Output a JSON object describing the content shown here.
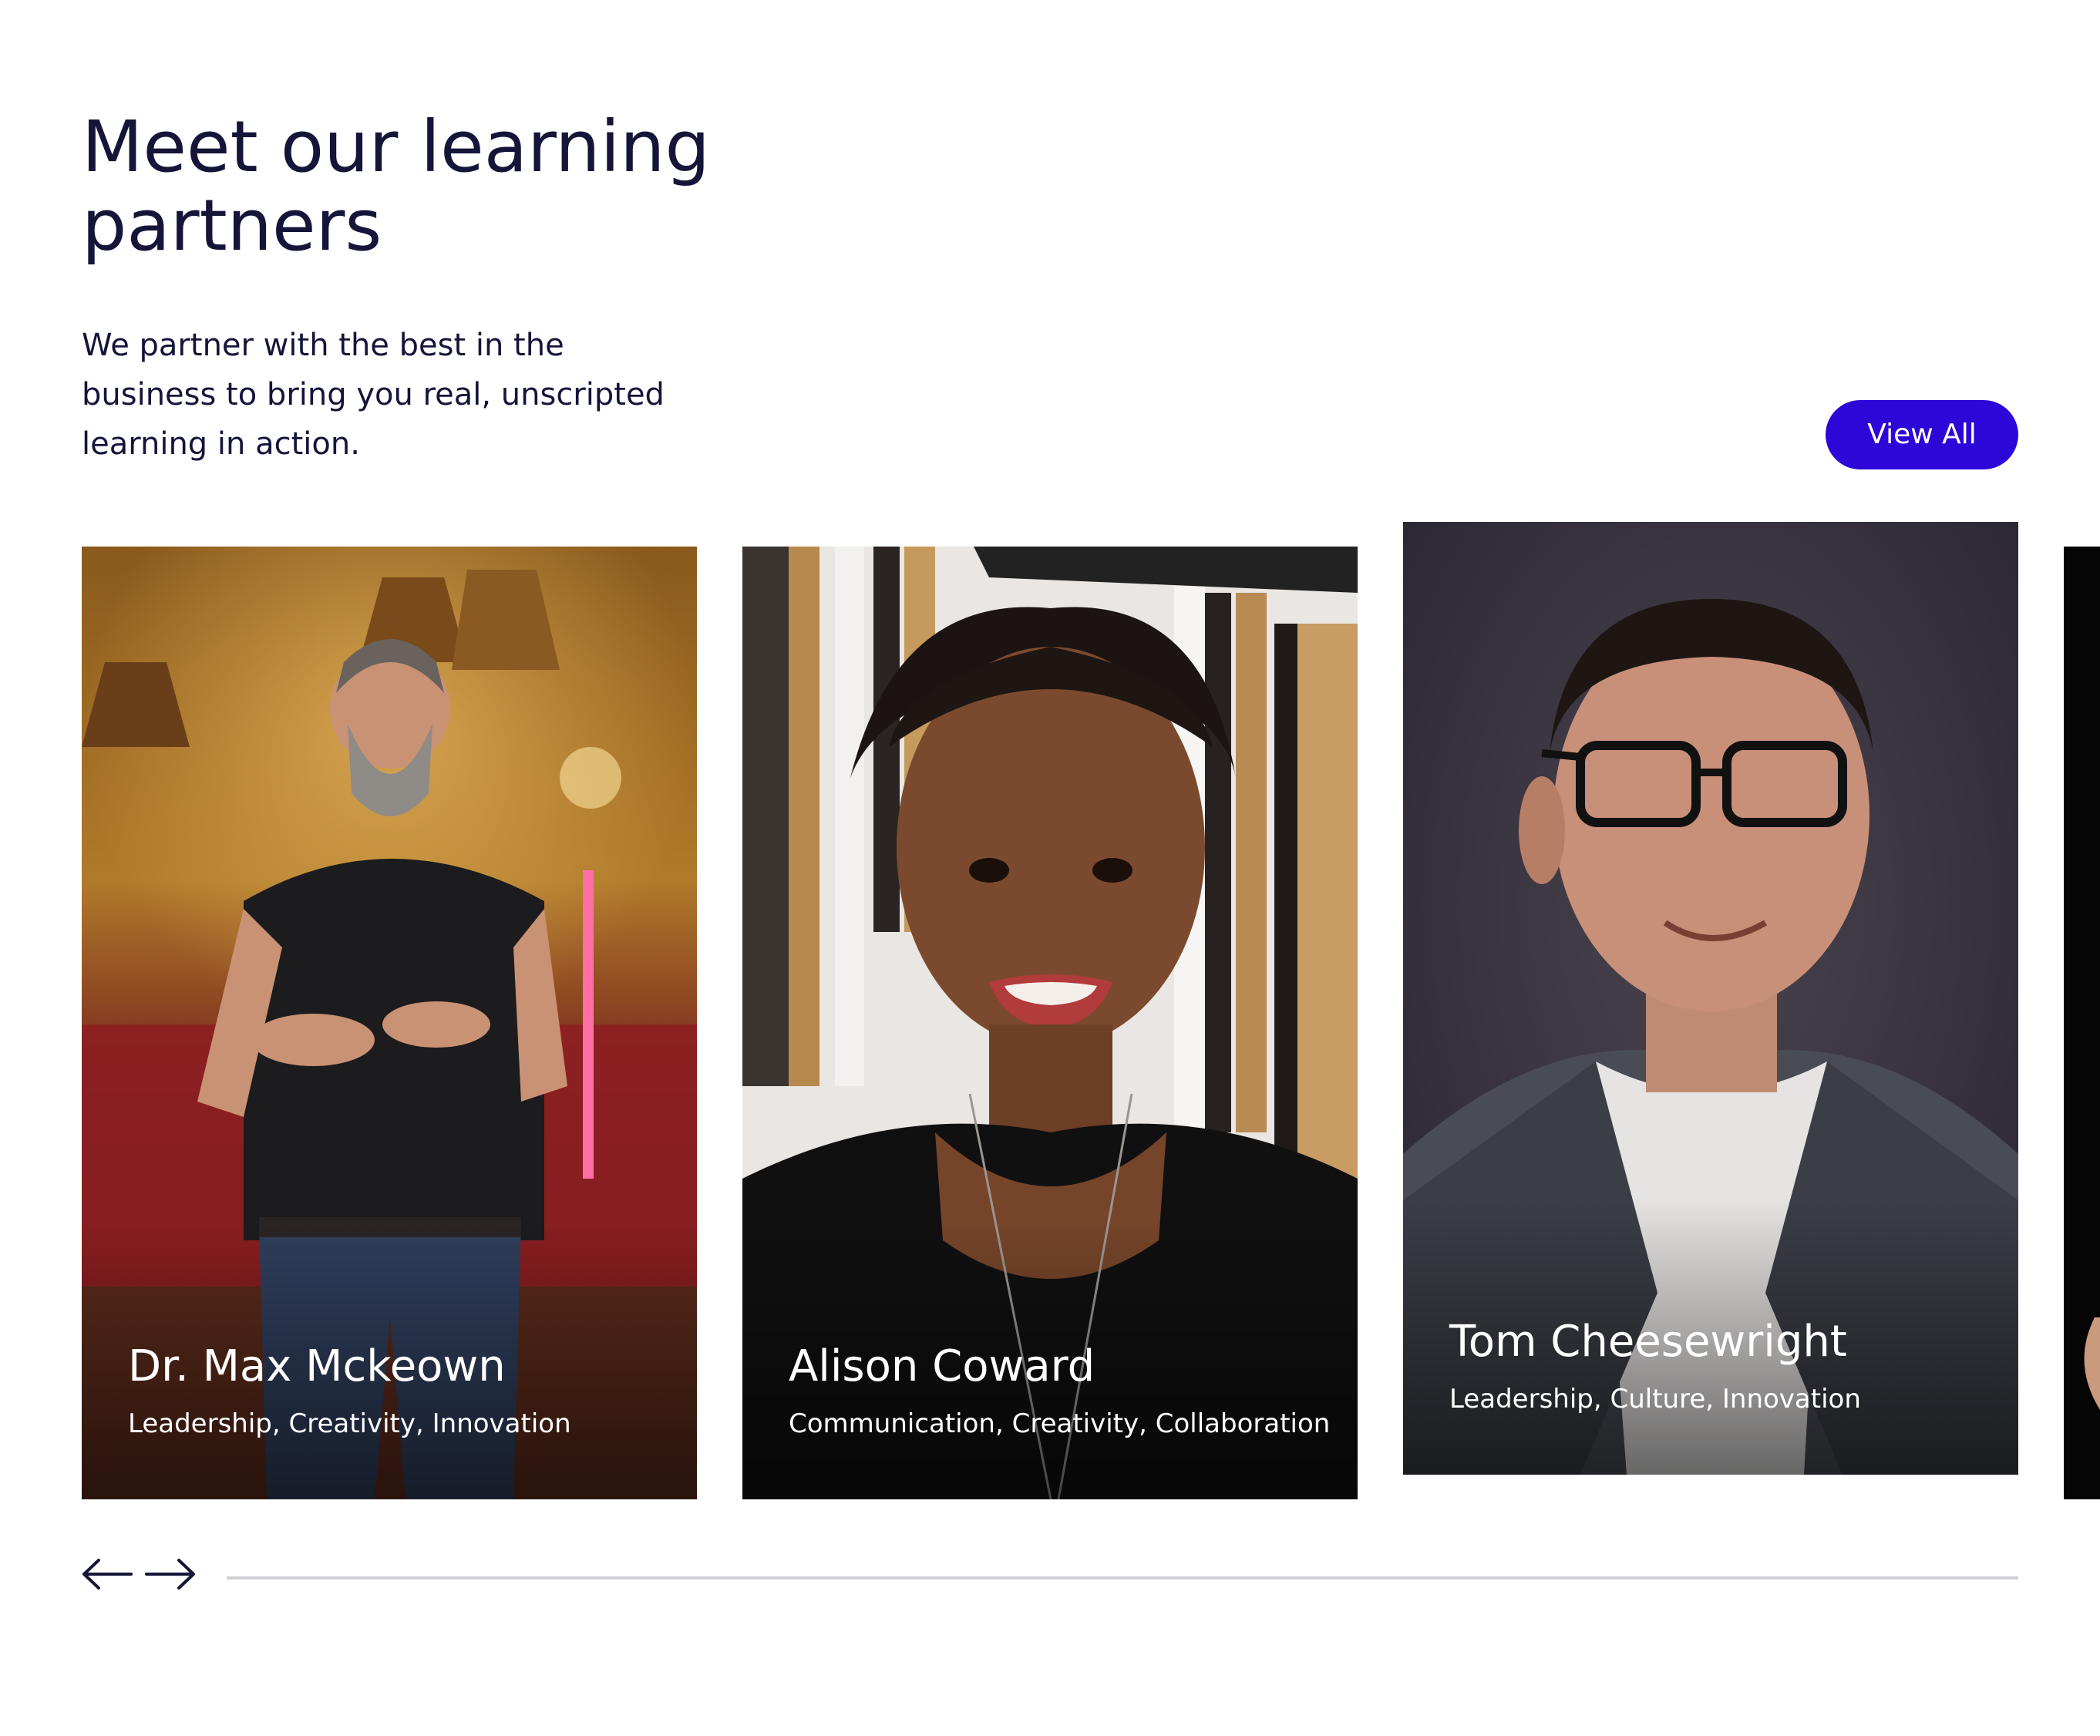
{
  "section": {
    "heading": "Meet our learning partners",
    "intro": "We partner with the best in the business to bring you real, unscripted learning in action.",
    "view_all_label": "View All"
  },
  "partners": [
    {
      "name": "Dr. Max Mckeown",
      "topics": "Leadership, Creativity, Innovation"
    },
    {
      "name": "Alison Coward",
      "topics": "Communication, Creativity, Collaboration"
    },
    {
      "name": "Tom Cheesewright",
      "topics": "Leadership, Culture, Innovation"
    }
  ],
  "carousel": {
    "prev_icon": "arrow-left-icon",
    "next_icon": "arrow-right-icon",
    "progress": 1.0
  },
  "colors": {
    "text": "#141539",
    "accent": "#2c07d8",
    "track": "#cfd0d6"
  }
}
